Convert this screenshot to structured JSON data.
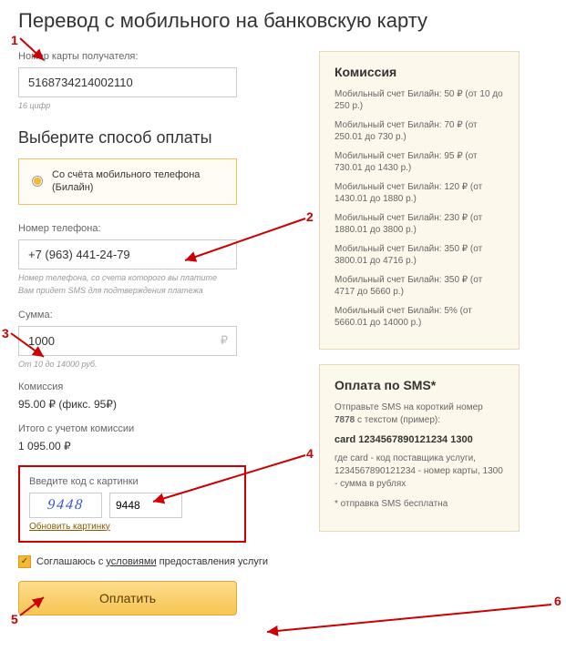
{
  "page_title": "Перевод с мобильного на банковскую карту",
  "card": {
    "label": "Номер карты получателя:",
    "value": "5168734214002110",
    "hint": "16 цифр"
  },
  "method_section_title": "Выберите способ оплаты",
  "method_radio": "Со счёта мобильного телефона (Билайн)",
  "phone": {
    "label": "Номер телефона:",
    "value": "+7 (963) 441-24-79",
    "hint1": "Номер телефона, со счета которого вы платите",
    "hint2": "Вам придет SMS для подтверждения платежа"
  },
  "amount": {
    "label": "Сумма:",
    "value": "1000",
    "currency": "₽",
    "hint": "От 10 до 14000 руб."
  },
  "commission": {
    "label": "Комиссия",
    "value": "95.00 ₽ (фикс. 95₽)"
  },
  "total": {
    "label": "Итого с учетом комиссии",
    "value": "1 095.00 ₽"
  },
  "captcha": {
    "label": "Введите код с картинки",
    "image_text": "9448",
    "input_value": "9448",
    "refresh": "Обновить картинку"
  },
  "agree": {
    "checked": true,
    "text_prefix": "Соглашаюсь с ",
    "terms_link": "условиями",
    "text_suffix": " предоставления услуги"
  },
  "pay_button": "Оплатить",
  "fees_box": {
    "title": "Комиссия",
    "rows": [
      "Мобильный счет Билайн: 50 ₽ (от 10 до 250 р.)",
      "Мобильный счет Билайн: 70 ₽ (от 250.01 до 730 р.)",
      "Мобильный счет Билайн: 95 ₽ (от 730.01 до 1430 р.)",
      "Мобильный счет Билайн: 120 ₽ (от 1430.01 до 1880 р.)",
      "Мобильный счет Билайн: 230 ₽ (от 1880.01 до 3800 р.)",
      "Мобильный счет Билайн: 350 ₽ (от 3800.01 до 4716 р.)",
      "Мобильный счет Билайн: 350 ₽ (от 4717 до 5660 р.)",
      "Мобильный счет Билайн: 5% (от 5660.01 до 14000 р.)"
    ]
  },
  "sms_box": {
    "title": "Оплата по SMS*",
    "line1_a": "Отправьте SMS на короткий номер ",
    "line1_num": "7878",
    "line1_b": " с текстом (пример):",
    "code": "card 1234567890121234 1300",
    "line2": "где card - код поставщика услуги, 1234567890121234 - номер карты, 1300 - сумма в рублях",
    "line3": "* отправка SMS бесплатна"
  },
  "annotations": [
    "1",
    "2",
    "3",
    "4",
    "5",
    "6"
  ]
}
